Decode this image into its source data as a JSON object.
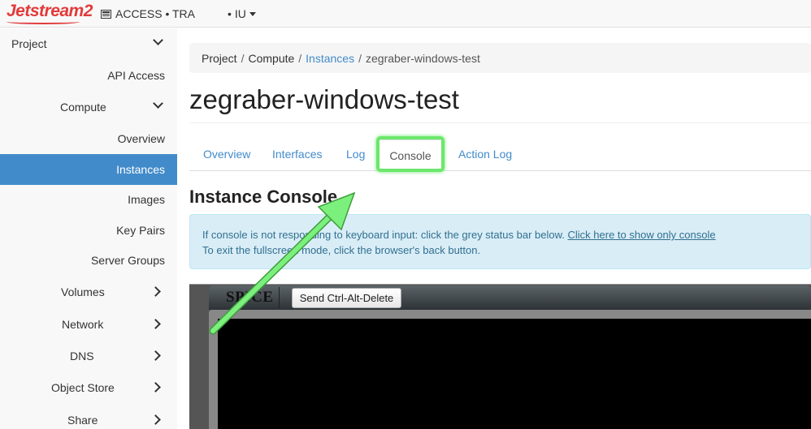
{
  "topbar": {
    "logo_text": "Jetstream2",
    "project_label": "ACCESS • TRA",
    "region_label": "IU"
  },
  "sidebar": {
    "items": [
      {
        "label": "Project"
      },
      {
        "label": "API Access"
      },
      {
        "label": "Compute"
      },
      {
        "label": "Overview"
      },
      {
        "label": "Instances"
      },
      {
        "label": "Images"
      },
      {
        "label": "Key Pairs"
      },
      {
        "label": "Server Groups"
      },
      {
        "label": "Volumes"
      },
      {
        "label": "Network"
      },
      {
        "label": "DNS"
      },
      {
        "label": "Object Store"
      },
      {
        "label": "Share"
      }
    ]
  },
  "breadcrumb": {
    "items": [
      "Project",
      "Compute",
      "Instances",
      "zegraber-windows-test"
    ],
    "separator": "/"
  },
  "page": {
    "title": "zegraber-windows-test"
  },
  "tabs": {
    "overview": "Overview",
    "interfaces": "Interfaces",
    "log": "Log",
    "console": "Console",
    "action_log": "Action Log"
  },
  "console_section": {
    "title": "Instance Console",
    "info_line1": "If console is not responding to keyboard input: click the grey status bar below.",
    "info_link": "Click here to show only console",
    "info_line2": "To exit the fullscreen mode, click the browser's back button."
  },
  "spice": {
    "logo": "SPICE",
    "send_button": "Send Ctrl-Alt-Delete"
  },
  "colors": {
    "accent": "#428bca",
    "highlight": "#6ce76c"
  }
}
